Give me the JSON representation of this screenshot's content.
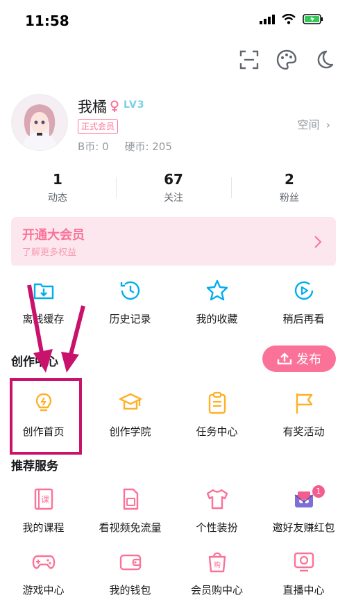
{
  "status_bar": {
    "time": "11:58"
  },
  "profile": {
    "name": "我橘",
    "level": "LV3",
    "badge": "正式会员",
    "coins": "B币: 0",
    "hard_coins": "硬币: 205",
    "space_label": "空间"
  },
  "stats": [
    {
      "value": "1",
      "label": "动态"
    },
    {
      "value": "67",
      "label": "关注"
    },
    {
      "value": "2",
      "label": "粉丝"
    }
  ],
  "vip": {
    "title": "开通大会员",
    "subtitle": "了解更多权益"
  },
  "quick": [
    {
      "label": "离线缓存",
      "icon": "download-icon"
    },
    {
      "label": "历史记录",
      "icon": "history-icon"
    },
    {
      "label": "我的收藏",
      "icon": "star-icon"
    },
    {
      "label": "稍后再看",
      "icon": "watch-later-icon"
    }
  ],
  "creation": {
    "title": "创作中心",
    "publish_label": "发布",
    "items": [
      {
        "label": "创作首页",
        "icon": "bulb-icon"
      },
      {
        "label": "创作学院",
        "icon": "academy-icon"
      },
      {
        "label": "任务中心",
        "icon": "task-icon"
      },
      {
        "label": "有奖活动",
        "icon": "flag-icon"
      }
    ]
  },
  "services": {
    "title": "推荐服务",
    "row1": [
      {
        "label": "我的课程",
        "icon": "course-icon"
      },
      {
        "label": "看视频免流量",
        "icon": "sim-icon"
      },
      {
        "label": "个性装扮",
        "icon": "shirt-icon"
      },
      {
        "label": "邀好友赚红包",
        "icon": "invite-icon",
        "badge": "1"
      }
    ],
    "row2": [
      {
        "label": "游戏中心",
        "icon": "gamepad-icon"
      },
      {
        "label": "我的钱包",
        "icon": "wallet-icon"
      },
      {
        "label": "会员购中心",
        "icon": "shop-bag-icon"
      },
      {
        "label": "直播中心",
        "icon": "live-icon"
      }
    ]
  },
  "colors": {
    "pink": "#fb7299",
    "blue": "#00aeec",
    "yellow": "#ffb027",
    "annotation": "#c8126b"
  }
}
